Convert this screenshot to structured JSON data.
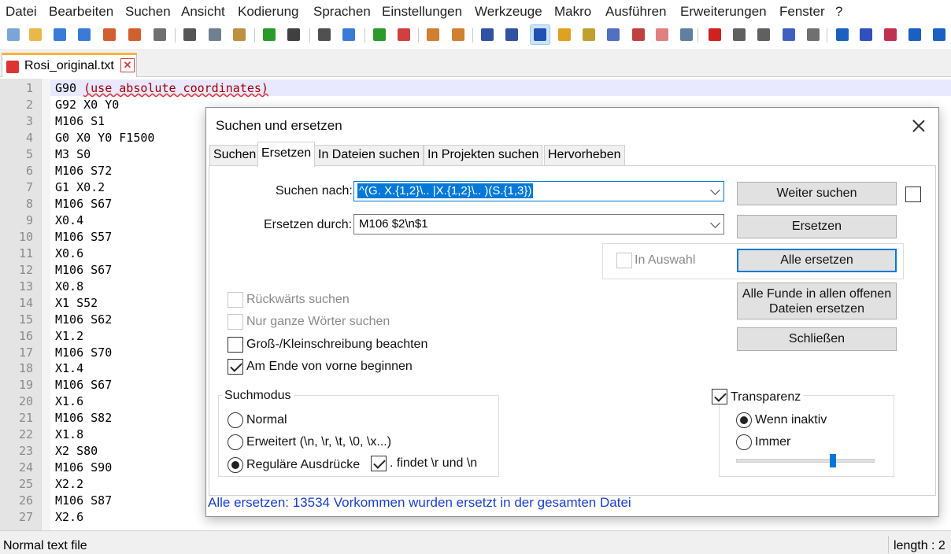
{
  "menu": [
    "Datei",
    "Bearbeiten",
    "Suchen",
    "Ansicht",
    "Kodierung",
    "Sprachen",
    "Einstellungen",
    "Werkzeuge",
    "Makro",
    "Ausführen",
    "Erweiterungen",
    "Fenster",
    "?"
  ],
  "toolbar": {
    "icons": [
      "new-file-icon",
      "open-file-icon",
      "save-icon",
      "save-all-icon",
      "close-icon",
      "close-all-icon",
      "print-icon",
      "cut-icon",
      "copy-icon",
      "paste-icon",
      "undo-icon",
      "redo-icon",
      "find-icon",
      "replace-icon",
      "zoom-in-icon",
      "zoom-out-icon",
      "sync-vertical-icon",
      "sync-horizontal-icon",
      "word-wrap-icon",
      "show-all-chars-icon",
      "indent-guide-icon",
      "udl-icon",
      "doc-map-icon",
      "doc-list-icon",
      "function-list-icon",
      "folder-workspace-icon",
      "monitoring-icon",
      "record-macro-icon",
      "stop-macro-icon",
      "play-macro-icon",
      "play-multiple-macro-icon",
      "save-macro-icon",
      "plugin-a-icon",
      "plugin-b-icon",
      "plugin-c-icon",
      "plugin-d-icon",
      "plugin-e-icon"
    ],
    "active_icon": "indent-guide-icon"
  },
  "tab": {
    "filename": "Rosi_original.txt",
    "close": "✕"
  },
  "editor": {
    "lines": [
      {
        "n": "1",
        "text": "G90 ",
        "comment": "(use absolute coordinates)"
      },
      {
        "n": "2",
        "text": "G92 X0 Y0"
      },
      {
        "n": "3",
        "text": "M106 S1"
      },
      {
        "n": "4",
        "text": "G0 X0 Y0 F1500"
      },
      {
        "n": "5",
        "text": "M3 S0"
      },
      {
        "n": "6",
        "text": "M106 S72"
      },
      {
        "n": "7",
        "text": "G1 X0.2"
      },
      {
        "n": "8",
        "text": "M106 S67"
      },
      {
        "n": "9",
        "text": "X0.4"
      },
      {
        "n": "10",
        "text": "M106 S57"
      },
      {
        "n": "11",
        "text": "X0.6"
      },
      {
        "n": "12",
        "text": "M106 S67"
      },
      {
        "n": "13",
        "text": "X0.8"
      },
      {
        "n": "14",
        "text": "X1 S52"
      },
      {
        "n": "15",
        "text": "M106 S62"
      },
      {
        "n": "16",
        "text": "X1.2"
      },
      {
        "n": "17",
        "text": "M106 S70"
      },
      {
        "n": "18",
        "text": "X1.4"
      },
      {
        "n": "19",
        "text": "M106 S67"
      },
      {
        "n": "20",
        "text": "X1.6"
      },
      {
        "n": "21",
        "text": "M106 S82"
      },
      {
        "n": "22",
        "text": "X1.8"
      },
      {
        "n": "23",
        "text": "X2 S80"
      },
      {
        "n": "24",
        "text": "M106 S90"
      },
      {
        "n": "25",
        "text": "X2.2"
      },
      {
        "n": "26",
        "text": "M106 S87"
      },
      {
        "n": "27",
        "text": "X2.6"
      }
    ]
  },
  "status": {
    "left": "Normal text file",
    "right": "length : 2"
  },
  "dialog": {
    "title": "Suchen und ersetzen",
    "tabs": [
      "Suchen",
      "Ersetzen",
      "In Dateien suchen",
      "In Projekten suchen",
      "Hervorheben"
    ],
    "selected_tab": "Ersetzen",
    "find_label": "Suchen nach:",
    "find_value": "^(G. X.{1,2}\\.. |X.{1,2}\\.. )(S.{1,3})",
    "replace_label": "Ersetzen durch:",
    "replace_value": "M106 $2\\n$1",
    "buttons": {
      "find_next": "Weiter suchen",
      "replace": "Ersetzen",
      "replace_all": "Alle ersetzen",
      "replace_all_open_1": "Alle Funde in allen offenen",
      "replace_all_open_2": "Dateien ersetzen",
      "close": "Schließen"
    },
    "in_selection": {
      "label": "In Auswahl",
      "checked": false,
      "enabled": false
    },
    "options": [
      {
        "label": "Rückwärts suchen",
        "checked": false,
        "enabled": false
      },
      {
        "label": "Nur ganze Wörter suchen",
        "checked": false,
        "enabled": false
      },
      {
        "label": "Groß-/Kleinschreibung beachten",
        "checked": false,
        "enabled": true
      },
      {
        "label": "Am Ende von vorne beginnen",
        "checked": true,
        "enabled": true
      }
    ],
    "search_mode": {
      "title": "Suchmodus",
      "options": [
        "Normal",
        "Erweitert (\\n, \\r, \\t, \\0, \\x...)",
        "Reguläre Ausdrücke"
      ],
      "selected": "Reguläre Ausdrücke",
      "dot_matches_newline": {
        "label": ". findet \\r und \\n",
        "checked": true
      }
    },
    "transparency": {
      "label": "Transparenz",
      "checked": true,
      "options": [
        "Wenn inaktiv",
        "Immer"
      ],
      "selected": "Wenn inaktiv",
      "level": 0.7
    },
    "status_message": "Alle ersetzen: 13534 Vorkommen wurden ersetzt in der gesamten Datei"
  },
  "colors": {
    "accent": "#0078d7",
    "status_text": "#1a3fc8",
    "comment": "#a00000",
    "tab_highlight": "#fab33b"
  }
}
